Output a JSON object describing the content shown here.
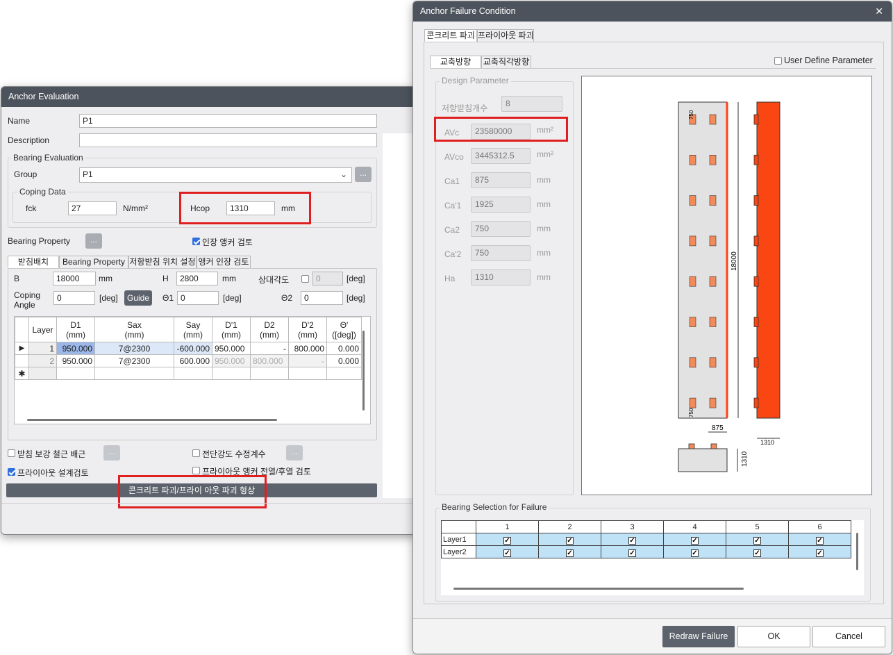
{
  "ae": {
    "title": "Anchor Evaluation",
    "name_label": "Name",
    "name_value": "P1",
    "desc_label": "Description",
    "desc_value": "",
    "bearing_eval": "Bearing Evaluation",
    "group_label": "Group",
    "group_value": "P1",
    "dots": "...",
    "coping_data": "Coping Data",
    "fck_label": "fck",
    "fck_value": "27",
    "fck_unit": "N/mm²",
    "hcop_label": "Hcop",
    "hcop_value": "1310",
    "hcop_unit": "mm",
    "bearing_prop_label": "Bearing Property",
    "anchor_check_label": "인장 앵커 검토",
    "tabs": [
      "받침배치",
      "Bearing Property",
      "저항받침 위치 설정",
      "앵커 인장 검토"
    ],
    "b_label": "B",
    "b_value": "18000",
    "b_unit": "mm",
    "h_label": "H",
    "h_value": "2800",
    "h_unit": "mm",
    "rel_angle_label": "상대각도",
    "rel_angle_value": "0",
    "deg": "[deg]",
    "coping_angle_label1": "Coping",
    "coping_angle_label2": "Angle",
    "coping_angle_value": "0",
    "guide": "Guide",
    "theta1_label": "Θ1",
    "theta1_value": "0",
    "theta2_label": "Θ2",
    "theta2_value": "0",
    "table": {
      "headers": [
        [
          "Layer",
          ""
        ],
        [
          "D1",
          "(mm)"
        ],
        [
          "Sax",
          "(mm)"
        ],
        [
          "Say",
          "(mm)"
        ],
        [
          "D'1",
          "(mm)"
        ],
        [
          "D2",
          "(mm)"
        ],
        [
          "D'2",
          "(mm)"
        ],
        [
          "Θ'",
          "([deg])"
        ]
      ],
      "rows": [
        [
          "1",
          "950.000",
          "7@2300",
          "-600.000",
          "950.000",
          "-",
          "800.000",
          "0.000"
        ],
        [
          "2",
          "950.000",
          "7@2300",
          "600.000",
          "950.000",
          "800.000",
          "-",
          "0.000"
        ]
      ],
      "new_row_marker": "✱",
      "current_marker": "▶"
    },
    "rebar_label": "받침 보강 철근 배근",
    "shear_factor_label": "전단강도 수정계수",
    "pryout_design_label": "프라이아웃 설계검토",
    "pryout_anchor_label": "프라이아웃 앵커 전열/후열 검토",
    "bottom_button": "콘크리트 파괴/프라이 아웃 파괴 형상"
  },
  "afc": {
    "title": "Anchor Failure Condition",
    "close": "✕",
    "outer_tabs": [
      "콘크리트 파괴",
      "프라이아웃 파괴"
    ],
    "inner_tabs": [
      "교축방향",
      "교축직각방향"
    ],
    "user_define": "User Define Parameter",
    "design_param": "Design Parameter",
    "params": [
      {
        "label": "저항받침개수",
        "value": "8",
        "unit": ""
      },
      {
        "label": "AVc",
        "value": "23580000",
        "unit": "mm²"
      },
      {
        "label": "AVco",
        "value": "3445312.5",
        "unit": "mm²"
      },
      {
        "label": "Ca1",
        "value": "875",
        "unit": "mm"
      },
      {
        "label": "Ca'1",
        "value": "1925",
        "unit": "mm"
      },
      {
        "label": "Ca2",
        "value": "750",
        "unit": "mm"
      },
      {
        "label": "Ca'2",
        "value": "750",
        "unit": "mm"
      },
      {
        "label": "Ha",
        "value": "1310",
        "unit": "mm"
      }
    ],
    "drawing": {
      "dim_750_top": "750",
      "dim_750_bot": "750",
      "dim_18000": "18000",
      "dim_875": "875",
      "dim_1310_h": "1310",
      "dim_1310_v": "1310"
    },
    "bearing_sel": "Bearing Selection for Failure",
    "sel_cols": [
      "1",
      "2",
      "3",
      "4",
      "5",
      "6"
    ],
    "sel_rows": [
      "Layer1",
      "Layer2"
    ],
    "redraw": "Redraw Failure",
    "ok": "OK",
    "cancel": "Cancel"
  }
}
